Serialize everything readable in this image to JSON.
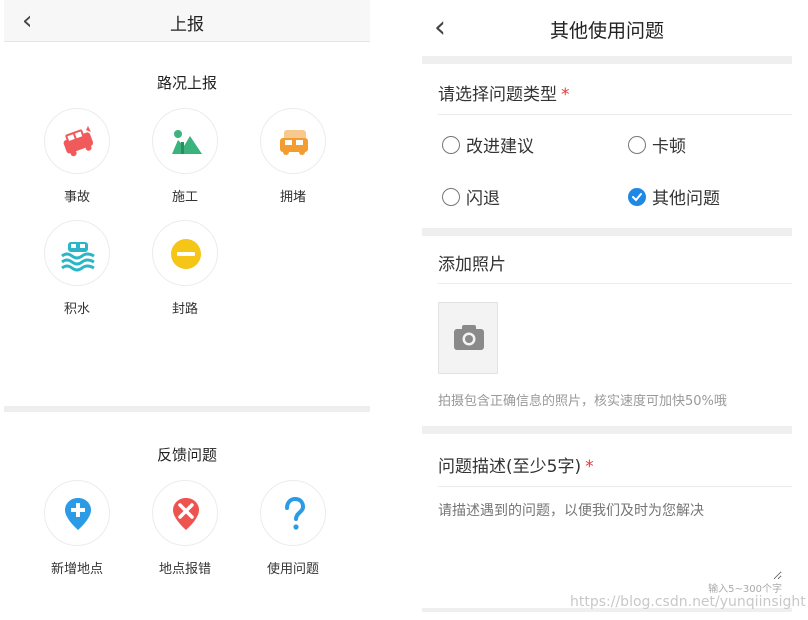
{
  "left": {
    "nav": {
      "back_icon": "chevron-left-icon",
      "back_glyph": "‹",
      "title": "上报"
    },
    "road_section": {
      "title": "路况上报",
      "items": [
        {
          "label": "事故",
          "icon": "car-crash-icon",
          "color": "#f05a5a"
        },
        {
          "label": "施工",
          "icon": "construction-icon",
          "color": "#3bb37c"
        },
        {
          "label": "拥堵",
          "icon": "traffic-jam-icon",
          "color": "#f39c2f"
        },
        {
          "label": "积水",
          "icon": "flood-icon",
          "color": "#29b6c6"
        },
        {
          "label": "封路",
          "icon": "road-closed-icon",
          "color": "#f5c518"
        }
      ]
    },
    "feedback_section": {
      "title": "反馈问题",
      "items": [
        {
          "label": "新增地点",
          "icon": "add-location-icon",
          "color": "#2b9be5"
        },
        {
          "label": "地点报错",
          "icon": "location-error-icon",
          "color": "#ef5350"
        },
        {
          "label": "使用问题",
          "icon": "question-icon",
          "color": "#2b9be5"
        }
      ]
    }
  },
  "right": {
    "nav": {
      "back_glyph": "‹",
      "title": "其他使用问题"
    },
    "type_label": "请选择问题类型",
    "required_mark": "*",
    "options": [
      {
        "label": "改进建议",
        "checked": false
      },
      {
        "label": "卡顿",
        "checked": false
      },
      {
        "label": "闪退",
        "checked": false
      },
      {
        "label": "其他问题",
        "checked": true
      }
    ],
    "photo_label": "添加照片",
    "photo_hint": "拍摄包含正确信息的照片，核实速度可加快50%哦",
    "desc_label": "问题描述(至少5字)",
    "desc_placeholder": "请描述遇到的问题，以便我们及时为您解决",
    "counter": "输入5~300个字",
    "accent": "#1e88e5"
  },
  "watermark": "https://blog.csdn.net/yunqiinsight"
}
